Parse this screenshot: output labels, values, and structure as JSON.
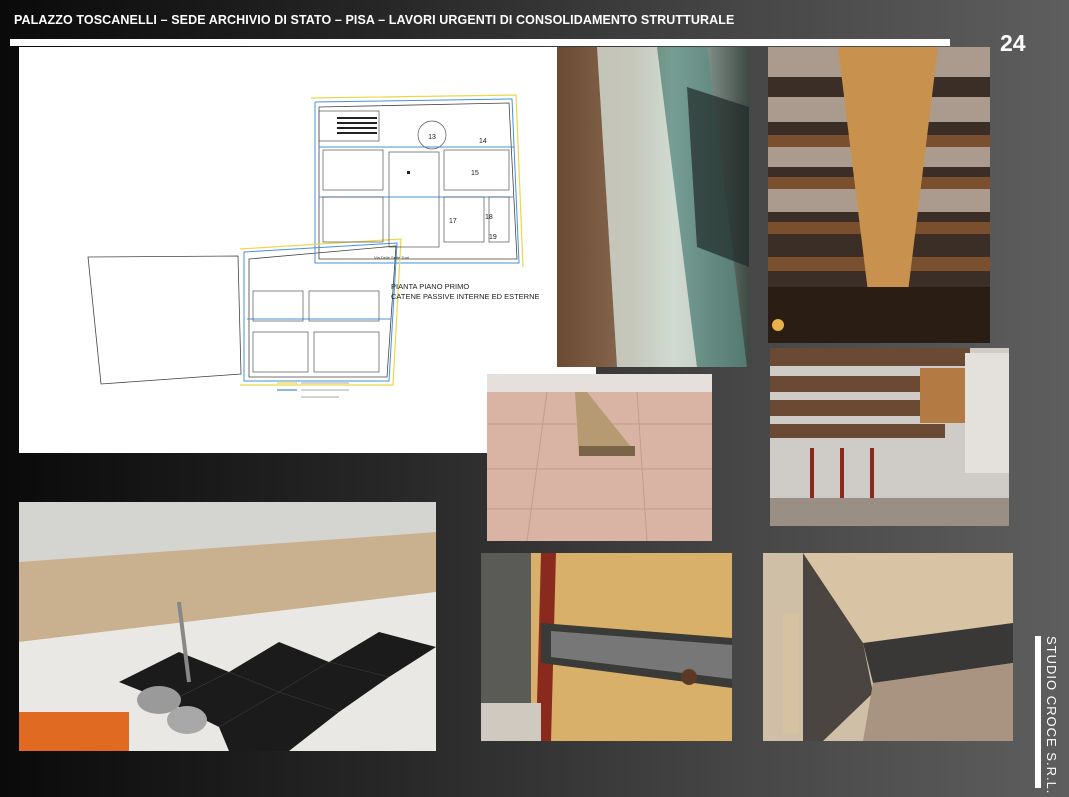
{
  "header": {
    "title": "PALAZZO TOSCANELLI – SEDE ARCHIVIO DI STATO – PISA – LAVORI URGENTI DI CONSOLIDAMENTO STRUTTURALE",
    "page_number": "24"
  },
  "footer": {
    "studio": "STUDIO CROCE S.R.L."
  },
  "plan": {
    "label_line1": "PIANTA PIANO PRIMO",
    "label_line2": "CATENE PASSIVE INTERNE ED ESTERNE",
    "street_label": "Via Delle Sette Torri",
    "room_numbers": [
      "13",
      "14",
      "15",
      "17",
      "18",
      "19"
    ]
  },
  "photos": [
    "wall-chase-closeup-photo",
    "timber-ceiling-beam-photo",
    "timber-plank-floor-photo",
    "timber-ceiling-props-photo",
    "tie-rod-floor-chase-photo",
    "steel-plate-wall-photo",
    "corner-steel-reinforcement-photo"
  ],
  "colors": {
    "background_dark": "#0a0a0a",
    "background_light": "#5e5e5e",
    "text": "#ffffff",
    "plan_blue": "#4a8fd8",
    "plan_yellow": "#e9d84a"
  }
}
